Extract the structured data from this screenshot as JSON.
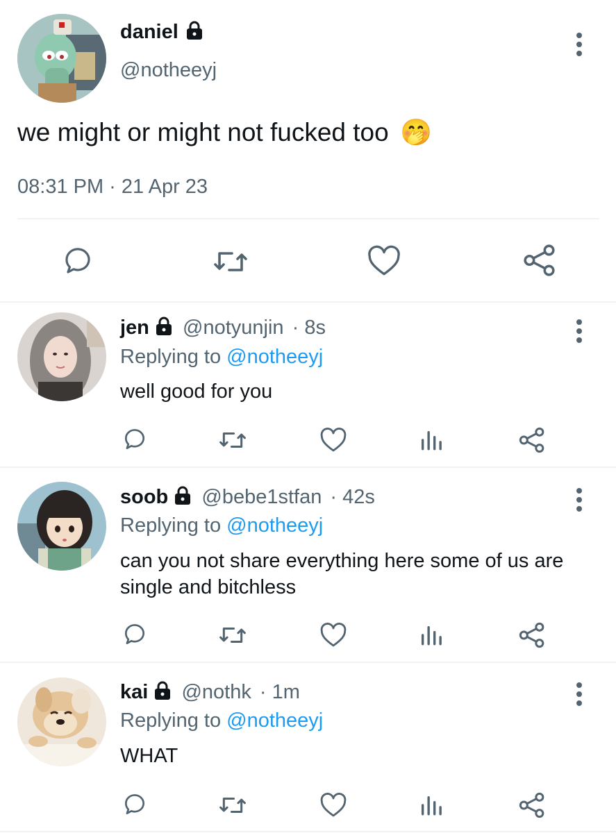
{
  "main_tweet": {
    "name": "daniel",
    "handle": "@notheeyj",
    "text": "we might or might not fucked too",
    "emoji": "🤭",
    "timestamp": "08:31 PM · 21 Apr 23"
  },
  "replies": [
    {
      "name": "jen",
      "handle": "@notyunjin",
      "time": "· 8s",
      "replying_prefix": "Replying to",
      "replying_handle": "@notheeyj",
      "text": "well good for you"
    },
    {
      "name": "soob",
      "handle": "@bebe1stfan",
      "time": "· 42s",
      "replying_prefix": "Replying to",
      "replying_handle": "@notheeyj",
      "text_line1": "can you not share everything here some of us are",
      "text_line2": "single and bitchless"
    },
    {
      "name": "kai",
      "handle": "@nothk",
      "time": "· 1m",
      "replying_prefix": "Replying to",
      "replying_handle": "@notheeyj",
      "text": "WHAT"
    }
  ],
  "icons": {
    "reply": "reply-icon",
    "retweet": "retweet-icon",
    "like": "heart-icon",
    "views": "views-icon",
    "share": "share-icon",
    "more": "more-icon",
    "lock": "lock-icon"
  },
  "colors": {
    "text": "#0f1419",
    "muted": "#536471",
    "link": "#1d9bf0",
    "divider": "#eff3f4"
  }
}
